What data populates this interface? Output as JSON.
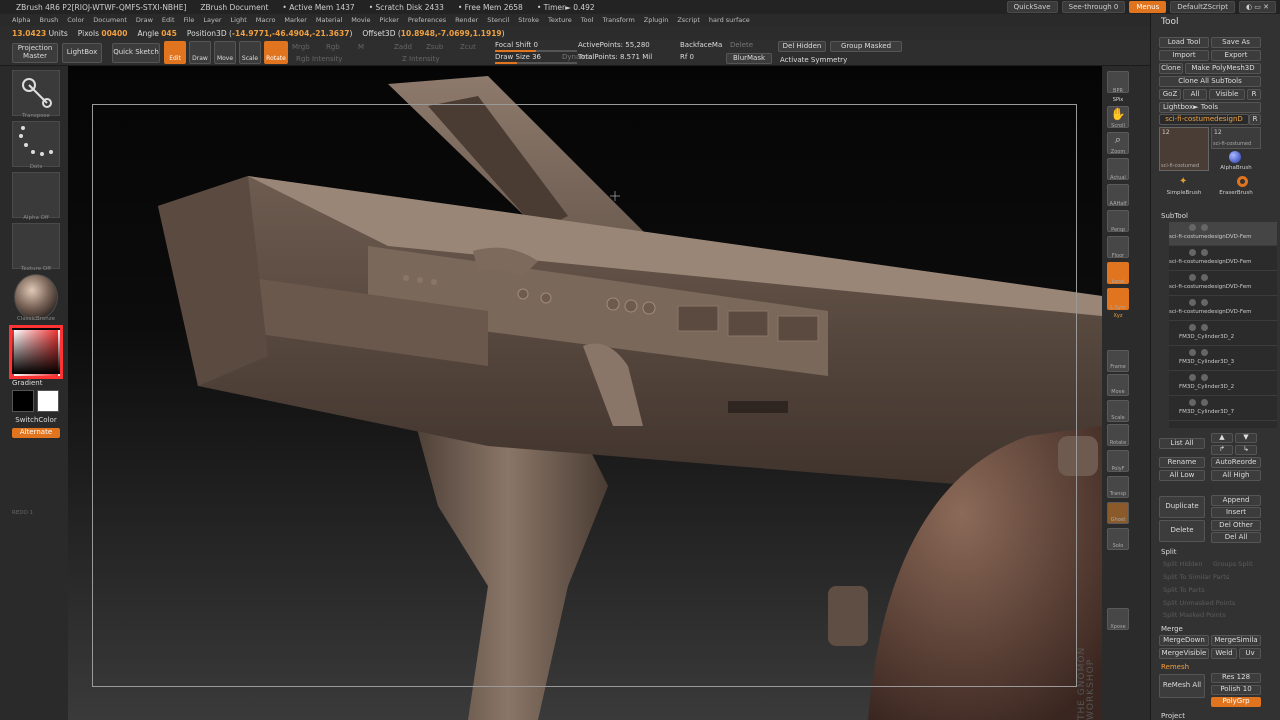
{
  "topbar": {
    "doc_title": "ZBrush 4R6 P2[RIOJ-WTWF-QMFS-STXI-NBHE]",
    "doc_name": "ZBrush Document",
    "active_mem": "• Active Mem 1437",
    "scratch": "• Scratch Disk 2433",
    "free_mem": "• Free Mem 2658",
    "timer": "• Timer► 0.492",
    "quicksave": "QuickSave",
    "seethrough": "See-through  0",
    "menus": "Menus",
    "default_zscript": "DefaultZScript"
  },
  "menubar": [
    "Alpha",
    "Brush",
    "Color",
    "Document",
    "Draw",
    "Edit",
    "File",
    "Layer",
    "Light",
    "Macro",
    "Marker",
    "Material",
    "Movie",
    "Picker",
    "Preferences",
    "Render",
    "Stencil",
    "Stroke",
    "Texture",
    "Tool",
    "Transform",
    "Zplugin",
    "Zscript",
    "hard surface"
  ],
  "infobar": {
    "units_val": "13.0423",
    "units": "Units",
    "pixols_label": "Pixols",
    "pixols_val": "00400",
    "angle_label": "Angle",
    "angle_val": "045",
    "pos_label": "Position3D",
    "pos_val": "-14.9771,-46.4904,-21.3637",
    "off_label": "Offset3D",
    "off_val": "10.8948,-7.0699,1.1919"
  },
  "toolbar": {
    "projection_master": "Projection Master",
    "lightbox": "LightBox",
    "quick_sketch": "Quick Sketch",
    "edit": "Edit",
    "draw": "Draw",
    "move": "Move",
    "scale": "Scale",
    "rotate": "Rotate",
    "mrgb": "Mrgb",
    "rgb": "Rgb",
    "m": "M",
    "zadd": "Zadd",
    "zsub": "Zsub",
    "zcut": "Zcut",
    "rgb_intensity": "Rgb Intensity",
    "z_intensity": "Z Intensity",
    "focal_shift": "Focal Shift 0",
    "draw_size": "Draw Size 36",
    "dynamic": "Dynamic",
    "active_points": "ActivePoints: 55,280",
    "total_points": "TotalPoints: 8.571 Mil",
    "backface": "BackfaceMa",
    "delete": "Delete",
    "rf": "Rf 0",
    "blur_mask": "BlurMask",
    "del_hidden": "Del Hidden",
    "group_masked": "Group Masked",
    "activate_symmetry": "Activate Symmetry"
  },
  "leftpanel": {
    "transpose": "Transpose",
    "dots": "Dots",
    "alpha_off": "Alpha Off",
    "texture_off": "Texture Off",
    "classic_bronze": "ClassicBronze",
    "gradient": "Gradient",
    "switch_color": "SwitchColor",
    "alternate": "Alternate",
    "redo": "REDO 1"
  },
  "rightshelf": [
    "BPR",
    "SPix",
    "Scroll",
    "Zoom",
    "Actual",
    "AAHalf",
    "Persp",
    "Floor",
    "Local",
    "L.Sym",
    "Xyz",
    "Frame",
    "Move",
    "Scale",
    "Rotate",
    "PolyF",
    "Transp",
    "Ghost",
    "Solo",
    "Xpose"
  ],
  "tray": {
    "title": "Tool",
    "load_tool": "Load Tool",
    "save_as": "Save As",
    "import": "Import",
    "export": "Export",
    "clone": "Clone",
    "make_polymesh": "Make PolyMesh3D",
    "clone_all": "Clone All SubTools",
    "goz": "GoZ",
    "all": "All",
    "visible": "Visible",
    "r": "R",
    "lightbox_tools": "Lightbox► Tools",
    "current_tool": "sci-fi-costumedesignD",
    "thumb_count_a": "12",
    "thumb_count_b": "12",
    "thumb_name_a": "sci-fi-costumed",
    "thumb_name_b": "sci-fi-costumed",
    "alpha_brush": "AlphaBrush",
    "simple_brush": "SimpleBrush",
    "eraser_brush": "EraserBrush",
    "subtool_header": "SubTool",
    "subtools": [
      "sci-fi-costumedesignDVD-Fem",
      "sci-fi-costumedesignDVD-Fem",
      "sci-fi-costumedesignDVD-Fem",
      "sci-fi-costumedesignDVD-Fem",
      "FM3D_Cylinder3D_2",
      "FM3D_Cylinder3D_3",
      "FM3D_Cylinder3D_2",
      "FM3D_Cylinder3D_7"
    ],
    "list_all": "List All",
    "rename": "Rename",
    "auto_reorder": "AutoReorde",
    "all_low": "All Low",
    "all_high": "All High",
    "duplicate": "Duplicate",
    "append": "Append",
    "insert": "Insert",
    "delete": "Delete",
    "del_other": "Del Other",
    "del_all": "Del All",
    "split_header": "Split",
    "split_items": [
      "Split Hidden",
      "Groups Split",
      "Split To Similar Parts",
      "Split To Parts",
      "Split Unmasked Points",
      "Split Masked Points"
    ],
    "merge_header": "Merge",
    "merge_down": "MergeDown",
    "merge_similar": "MergeSimila",
    "merge_visible": "MergeVisible",
    "weld": "Weld",
    "uv": "Uv",
    "remesh_header": "Remesh",
    "remesh_all": "ReMesh All",
    "res": "Res 128",
    "polish": "Polish 10",
    "polygrp": "PolyGrp",
    "project_header": "Project"
  },
  "watermark": "THE GNOMON WORKSHOP",
  "colors": {
    "accent": "#e0741f",
    "bronze": "#7a6458"
  }
}
